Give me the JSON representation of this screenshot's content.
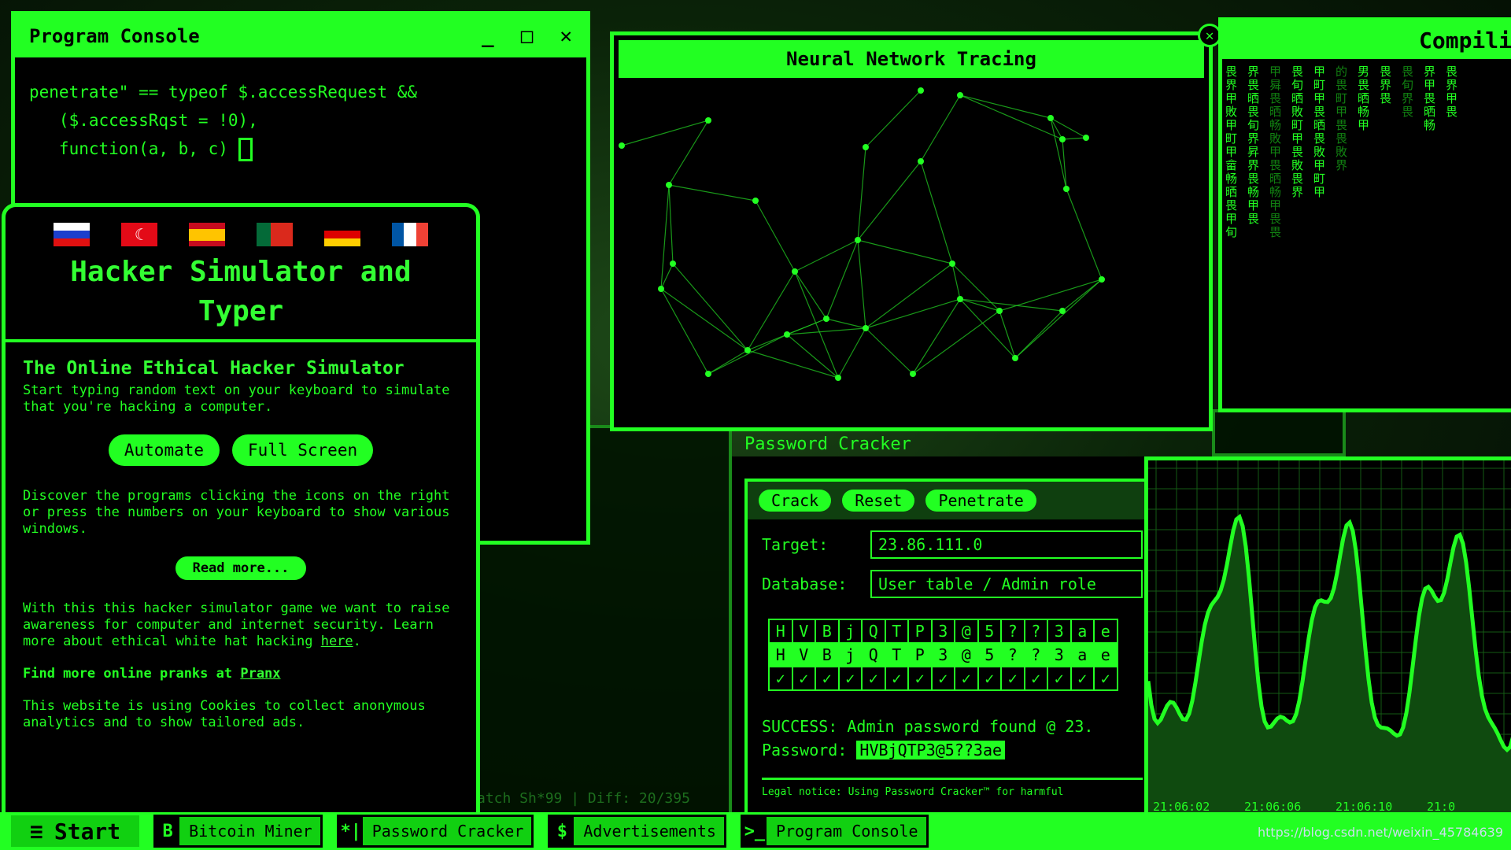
{
  "program_console": {
    "title": "Program Console",
    "controls": [
      "_",
      "□",
      "✕"
    ],
    "code_lines": [
      "penetrate\" == typeof $.accessRequest &&",
      "   ($.accessRqst = !0),",
      "   function(a, b, c) "
    ]
  },
  "info": {
    "title": "Hacker Simulator and Typer",
    "flags": [
      "ru",
      "tr",
      "es",
      "pt",
      "de",
      "fr"
    ],
    "subtitle": "The Online Ethical Hacker Simulator",
    "intro": "Start typing random text on your keyboard to simulate that you're hacking a computer.",
    "automate": "Automate",
    "fullscreen": "Full Screen",
    "discover": "Discover the programs clicking the icons on the right or press the numbers on your keyboard to show various windows.",
    "read_more": "Read more...",
    "awareness": "With this this hacker simulator game we want to raise awareness for computer and internet security. Learn more about ethical white hat hacking ",
    "here": "here",
    "period": ".",
    "pranks": "Find more online pranks at ",
    "pranx": "Pranx",
    "cookies": "This website is using Cookies to collect anonymous analytics and to show tailored ads."
  },
  "neural": {
    "title": "Neural Network Tracing"
  },
  "compiling": {
    "title": "Compili",
    "columns": [
      "畏界甲敗甲町甲畲畅晒畏甲旬",
      "界畏晒畏旬界昇界畏畅甲畏",
      "甲曻畏晒畅敗甲畏晒畅甲畏畏",
      "畏旬晒敗町甲畏敗畏界",
      "甲町甲畏晒畏敗甲町甲",
      "的畏町甲畏畏敗界",
      "男畏晒畅甲",
      "畏界畏",
      "畏旬界畏",
      "界甲畏晒畅",
      "畏界甲畏"
    ]
  },
  "password_cracker": {
    "title": "Password Cracker",
    "tabs": [
      "Crack",
      "Reset",
      "Penetrate"
    ],
    "target_label": "Target:",
    "target_value": "23.86.111.0",
    "database_label": "Database:",
    "database_value": "User table / Admin role",
    "grid_top": [
      "H",
      "V",
      "B",
      "j",
      "Q",
      "T",
      "P",
      "3",
      "@",
      "5",
      "?",
      "?",
      "3",
      "a",
      "e"
    ],
    "grid_mid": [
      "H",
      "V",
      "B",
      "j",
      "Q",
      "T",
      "P",
      "3",
      "@",
      "5",
      "?",
      "?",
      "3",
      "a",
      "e"
    ],
    "check": "✓",
    "success": "SUCCESS: Admin password found @ 23.",
    "password_label": "Password:",
    "password_value": "HVBjQTP3@5??3ae",
    "legal": "Legal notice: Using Password Cracker™ for harmful"
  },
  "graph": {
    "times": [
      "21:06:02",
      "21:06:06",
      "21:06:10",
      "21:0"
    ]
  },
  "bitcoin_bg": {
    "status": "atch Sh*99 | Diff: 20/395"
  },
  "taskbar": {
    "start": "Start",
    "items": [
      {
        "icon": "B",
        "label": "Bitcoin Miner"
      },
      {
        "icon": "*|",
        "label": "Password Cracker"
      },
      {
        "icon": "$",
        "label": "Advertisements"
      },
      {
        "icon": ">_",
        "label": "Program Console"
      }
    ]
  },
  "watermark": "https://blog.csdn.net/weixin_45784639",
  "colors": {
    "accent": "#22ff22",
    "bg": "#000000"
  }
}
